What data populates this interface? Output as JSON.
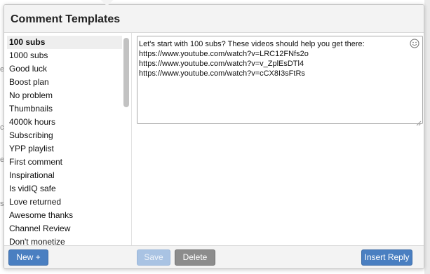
{
  "dialog": {
    "title": "Comment Templates"
  },
  "templates": {
    "selected_index": 0,
    "items": [
      {
        "label": "100 subs"
      },
      {
        "label": "1000 subs"
      },
      {
        "label": "Good luck"
      },
      {
        "label": "Boost plan"
      },
      {
        "label": "No problem"
      },
      {
        "label": "Thumbnails"
      },
      {
        "label": "4000k hours"
      },
      {
        "label": "Subscribing"
      },
      {
        "label": "YPP playlist"
      },
      {
        "label": "First comment"
      },
      {
        "label": "Inspirational"
      },
      {
        "label": "Is vidIQ safe"
      },
      {
        "label": "Love returned"
      },
      {
        "label": "Awesome thanks"
      },
      {
        "label": "Channel Review"
      },
      {
        "label": "Don't monetize"
      }
    ]
  },
  "editor": {
    "text": "Let's start with 100 subs? These videos should help you get there:\nhttps://www.youtube.com/watch?v=LRC12FNfs2o\nhttps://www.youtube.com/watch?v=v_ZplEsDTl4\nhttps://www.youtube.com/watch?v=cCX8I3sFtRs",
    "emoji_icon": "smiley-icon"
  },
  "footer": {
    "new_label": "New +",
    "save_label": "Save",
    "delete_label": "Delete",
    "insert_label": "Insert Reply"
  },
  "background": {
    "side_letters": [
      "e",
      "c",
      "e",
      "s"
    ]
  },
  "colors": {
    "primary_button": "#4a7fc1",
    "disabled_button": "#a9c3e3",
    "gray_button": "#8c8c8c",
    "header_bg": "#f3f3f3",
    "selected_row": "#eeeeee"
  }
}
